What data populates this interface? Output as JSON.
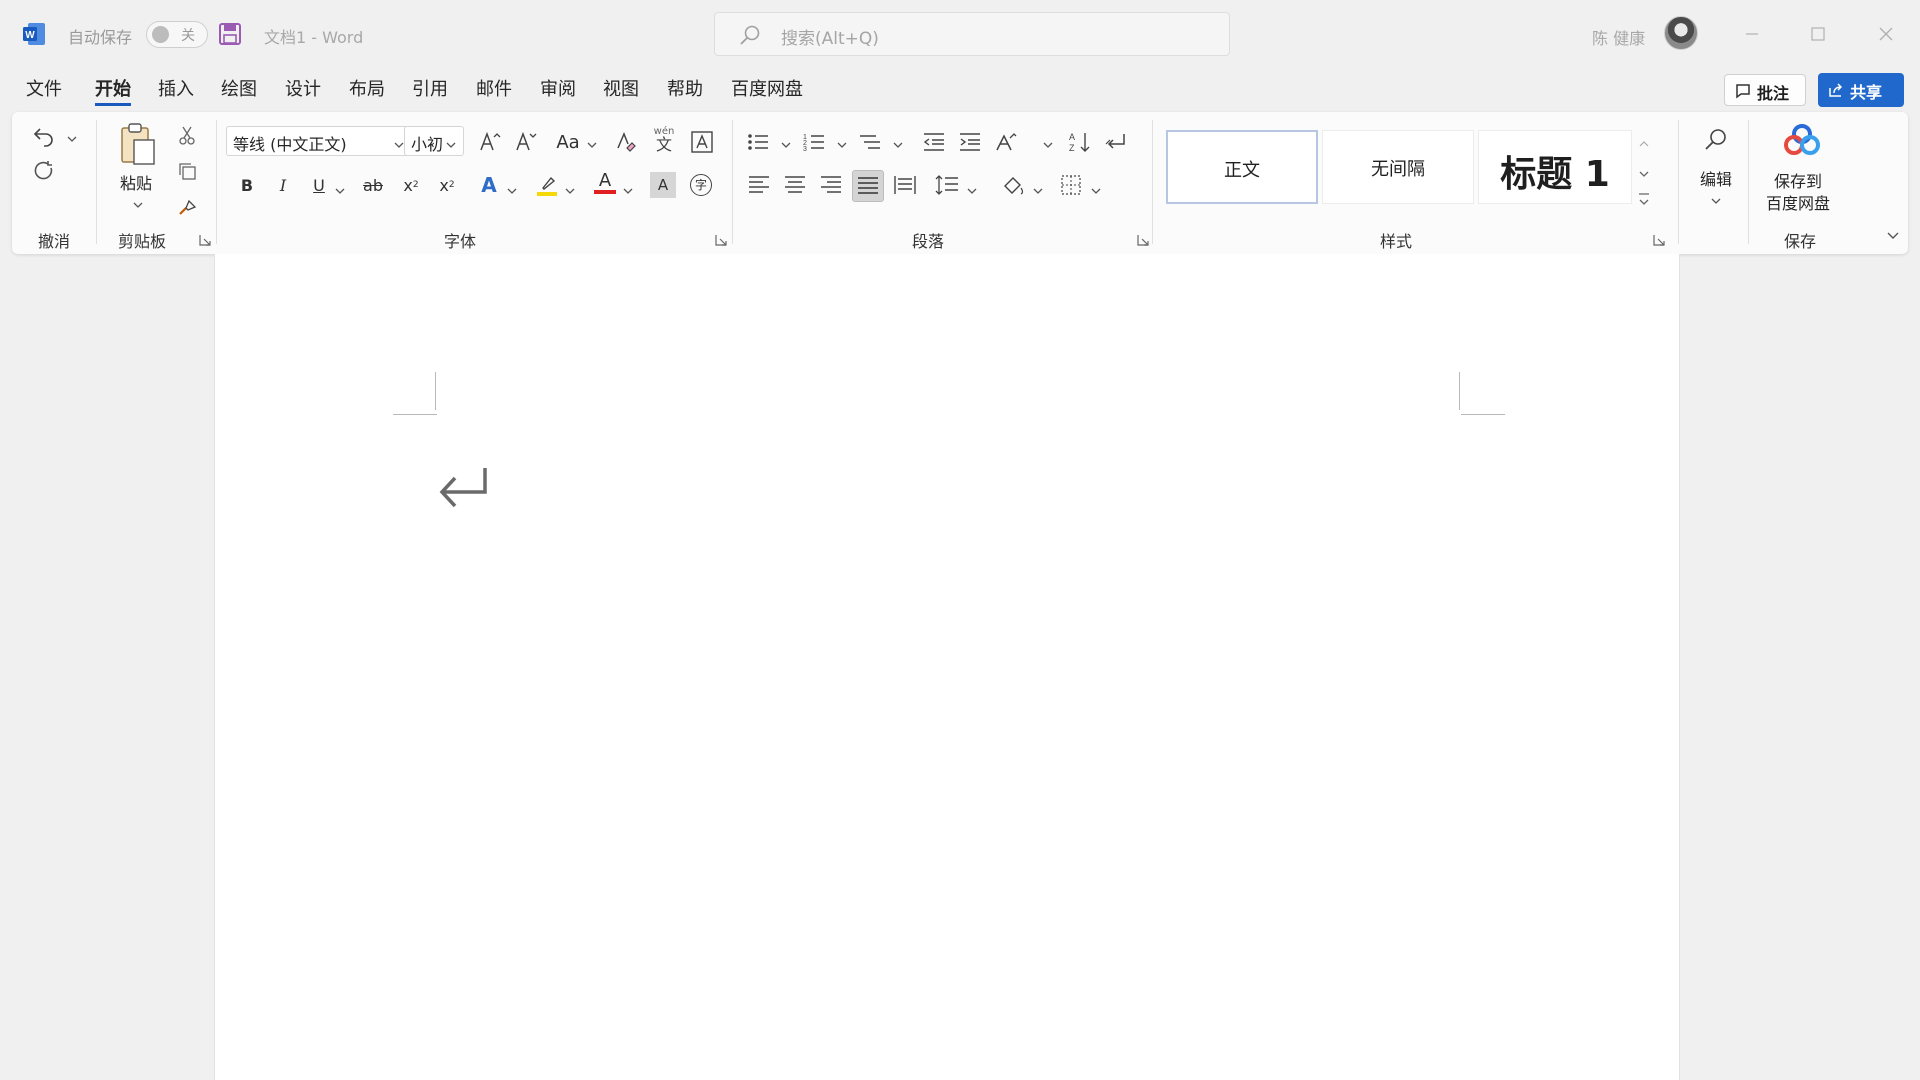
{
  "titlebar": {
    "autosave_label": "自动保存",
    "autosave_state": "关",
    "doc_title": "文档1  -  Word",
    "search_placeholder": "搜索(Alt+Q)",
    "user_name": "陈 健康"
  },
  "menu": {
    "tabs": [
      {
        "label": "文件"
      },
      {
        "label": "开始",
        "active": true
      },
      {
        "label": "插入"
      },
      {
        "label": "绘图"
      },
      {
        "label": "设计"
      },
      {
        "label": "布局"
      },
      {
        "label": "引用"
      },
      {
        "label": "邮件"
      },
      {
        "label": "审阅"
      },
      {
        "label": "视图"
      },
      {
        "label": "帮助"
      },
      {
        "label": "百度网盘"
      }
    ],
    "comment_label": "批注",
    "share_label": "共享"
  },
  "ribbon": {
    "undo_group": "撤消",
    "clipboard": {
      "paste_label": "粘贴",
      "group": "剪贴板"
    },
    "font": {
      "font_name": "等线 (中文正文)",
      "font_size": "小初",
      "case_label": "Aa",
      "bold": "B",
      "italic": "I",
      "underline": "U",
      "strike": "ab",
      "subscript": "x",
      "superscript": "x",
      "text_effect": "A",
      "font_color": "A",
      "char_shading": "A",
      "enclose": "字",
      "phonetic": "wén",
      "group": "字体"
    },
    "paragraph": {
      "group": "段落"
    },
    "styles": {
      "items": [
        "正文",
        "无间隔",
        "标题 1"
      ],
      "group": "样式"
    },
    "editing": {
      "label": "编辑"
    },
    "save": {
      "label_line1": "保存到",
      "label_line2": "百度网盘",
      "group": "保存"
    }
  },
  "colors": {
    "accent": "#185abd",
    "share_button": "#2168cc",
    "highlight": "#f5d80a",
    "font_red": "#e02020",
    "ribbon_bg": "#fbfbfb",
    "app_bg": "#f0f0f0"
  }
}
